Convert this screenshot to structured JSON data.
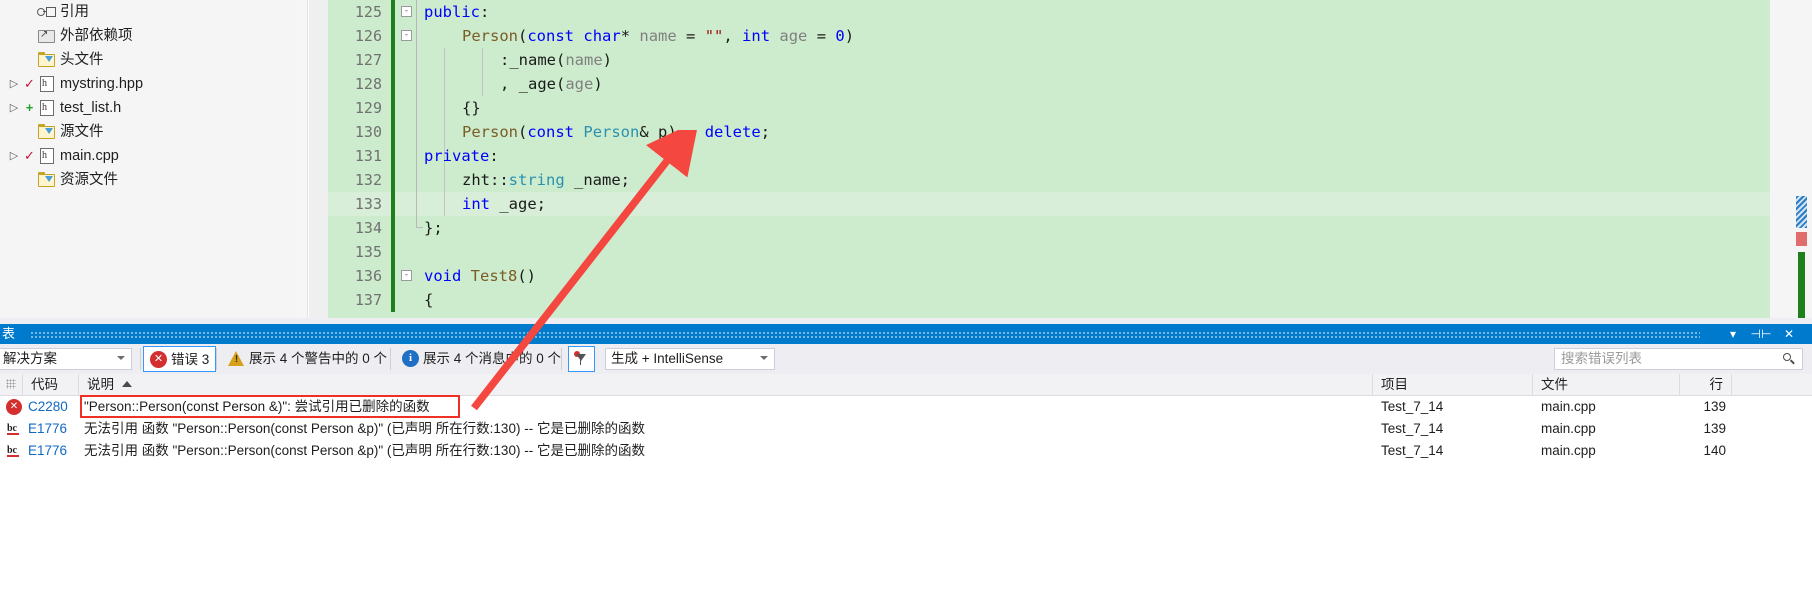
{
  "solution_explorer": {
    "items": [
      {
        "label": "引用",
        "icon": "references-icon",
        "expander": "",
        "status": ""
      },
      {
        "label": "外部依赖项",
        "icon": "external-deps-icon",
        "expander": "",
        "status": ""
      },
      {
        "label": "头文件",
        "icon": "filter-folder-icon",
        "expander": "",
        "status": ""
      },
      {
        "label": "mystring.hpp",
        "icon": "header-file-icon",
        "expander": "▷",
        "status": "✓"
      },
      {
        "label": "test_list.h",
        "icon": "header-file-icon",
        "expander": "▷",
        "status": "+"
      },
      {
        "label": "源文件",
        "icon": "filter-folder-icon",
        "expander": "",
        "status": ""
      },
      {
        "label": "main.cpp",
        "icon": "cpp-file-icon",
        "expander": "▷",
        "status": "✓"
      },
      {
        "label": "资源文件",
        "icon": "filter-folder-icon",
        "expander": "",
        "status": ""
      }
    ]
  },
  "editor": {
    "current_line": 133,
    "lines": [
      {
        "no": "125",
        "fold": "-",
        "tokens": [
          {
            "t": "public",
            "c": "key"
          },
          {
            "t": ":",
            "c": "plain"
          }
        ],
        "indent": 0
      },
      {
        "no": "126",
        "fold": "-",
        "tokens": [
          {
            "t": "Person",
            "c": "fn"
          },
          {
            "t": "(",
            "c": "plain"
          },
          {
            "t": "const",
            "c": "key"
          },
          {
            "t": " ",
            "c": "plain"
          },
          {
            "t": "char",
            "c": "key"
          },
          {
            "t": "* ",
            "c": "plain"
          },
          {
            "t": "name",
            "c": "param"
          },
          {
            "t": " = ",
            "c": "plain"
          },
          {
            "t": "\"\"",
            "c": "str"
          },
          {
            "t": ", ",
            "c": "plain"
          },
          {
            "t": "int",
            "c": "key"
          },
          {
            "t": " ",
            "c": "plain"
          },
          {
            "t": "age",
            "c": "param"
          },
          {
            "t": " = ",
            "c": "plain"
          },
          {
            "t": "0",
            "c": "num"
          },
          {
            "t": ")",
            "c": "plain"
          }
        ],
        "indent": 1
      },
      {
        "no": "127",
        "fold": "",
        "tokens": [
          {
            "t": ":_name",
            "c": "plain"
          },
          {
            "t": "(",
            "c": "plain"
          },
          {
            "t": "name",
            "c": "param"
          },
          {
            "t": ")",
            "c": "plain"
          }
        ],
        "indent": 2
      },
      {
        "no": "128",
        "fold": "",
        "tokens": [
          {
            "t": ", _age",
            "c": "plain"
          },
          {
            "t": "(",
            "c": "plain"
          },
          {
            "t": "age",
            "c": "param"
          },
          {
            "t": ")",
            "c": "plain"
          }
        ],
        "indent": 2
      },
      {
        "no": "129",
        "fold": "",
        "tokens": [
          {
            "t": "{}",
            "c": "plain"
          }
        ],
        "indent": 1
      },
      {
        "no": "130",
        "fold": "",
        "tokens": [
          {
            "t": "Person",
            "c": "fn"
          },
          {
            "t": "(",
            "c": "plain"
          },
          {
            "t": "const",
            "c": "key"
          },
          {
            "t": " ",
            "c": "plain"
          },
          {
            "t": "Person",
            "c": "type"
          },
          {
            "t": "& p) = ",
            "c": "plain"
          },
          {
            "t": "delete",
            "c": "key"
          },
          {
            "t": ";",
            "c": "plain"
          }
        ],
        "indent": 1
      },
      {
        "no": "131",
        "fold": "",
        "tokens": [
          {
            "t": "private",
            "c": "key"
          },
          {
            "t": ":",
            "c": "plain"
          }
        ],
        "indent": 0
      },
      {
        "no": "132",
        "fold": "",
        "tokens": [
          {
            "t": "zht::",
            "c": "plain"
          },
          {
            "t": "string",
            "c": "type"
          },
          {
            "t": " _name;",
            "c": "plain"
          }
        ],
        "indent": 1
      },
      {
        "no": "133",
        "fold": "",
        "tokens": [
          {
            "t": "int",
            "c": "key"
          },
          {
            "t": " _age;",
            "c": "plain"
          }
        ],
        "indent": 1
      },
      {
        "no": "134",
        "fold": "",
        "tokens": [
          {
            "t": "};",
            "c": "plain"
          }
        ],
        "indent": 0
      },
      {
        "no": "135",
        "fold": "",
        "tokens": [],
        "indent": 0
      },
      {
        "no": "136",
        "fold": "-",
        "tokens": [
          {
            "t": "void",
            "c": "key"
          },
          {
            "t": " ",
            "c": "plain"
          },
          {
            "t": "Test8",
            "c": "fn"
          },
          {
            "t": "()",
            "c": "plain"
          }
        ],
        "indent": 0
      },
      {
        "no": "137",
        "fold": "",
        "tokens": [
          {
            "t": "{",
            "c": "plain"
          }
        ],
        "indent": 0
      }
    ]
  },
  "error_panel": {
    "title": "表",
    "title_buttons": [
      "▾",
      "⊣⊢",
      "✕"
    ],
    "toolbar": {
      "scope_select": "解决方案",
      "error_button": "错误 3",
      "warning_button": "展示 4 个警告中的 0 个",
      "message_button": "展示 4 个消息中的 0 个",
      "filter_icon": "filter-icon",
      "build_combo": "生成 + IntelliSense",
      "search_placeholder": "搜索错误列表",
      "search_icon": "search-icon"
    },
    "columns": [
      {
        "key": "code",
        "label": "代码",
        "sorted": false
      },
      {
        "key": "desc",
        "label": "说明",
        "sorted": true
      },
      {
        "key": "proj",
        "label": "项目",
        "sorted": false
      },
      {
        "key": "file",
        "label": "文件",
        "sorted": false
      },
      {
        "key": "line",
        "label": "行",
        "sorted": false
      }
    ],
    "rows": [
      {
        "severity": "error",
        "code": "C2280",
        "desc": "\"Person::Person(const Person &)\": 尝试引用已删除的函数",
        "proj": "Test_7_14",
        "file": "main.cpp",
        "line": "139",
        "highlighted": true
      },
      {
        "severity": "intellisense",
        "code": "E1776",
        "desc": "无法引用 函数 \"Person::Person(const Person &p)\" (已声明 所在行数:130) -- 它是已删除的函数",
        "proj": "Test_7_14",
        "file": "main.cpp",
        "line": "139",
        "highlighted": false
      },
      {
        "severity": "intellisense",
        "code": "E1776",
        "desc": "无法引用 函数 \"Person::Person(const Person &p)\" (已声明 所在行数:130) -- 它是已删除的函数",
        "proj": "Test_7_14",
        "file": "main.cpp",
        "line": "140",
        "highlighted": false
      }
    ]
  },
  "colors": {
    "accent": "#007acc",
    "editor_saved_green": "#cdeccd",
    "annotation_red": "#ee3124",
    "error_red": "#d32f2f",
    "save_bar_green": "#1d801d"
  }
}
